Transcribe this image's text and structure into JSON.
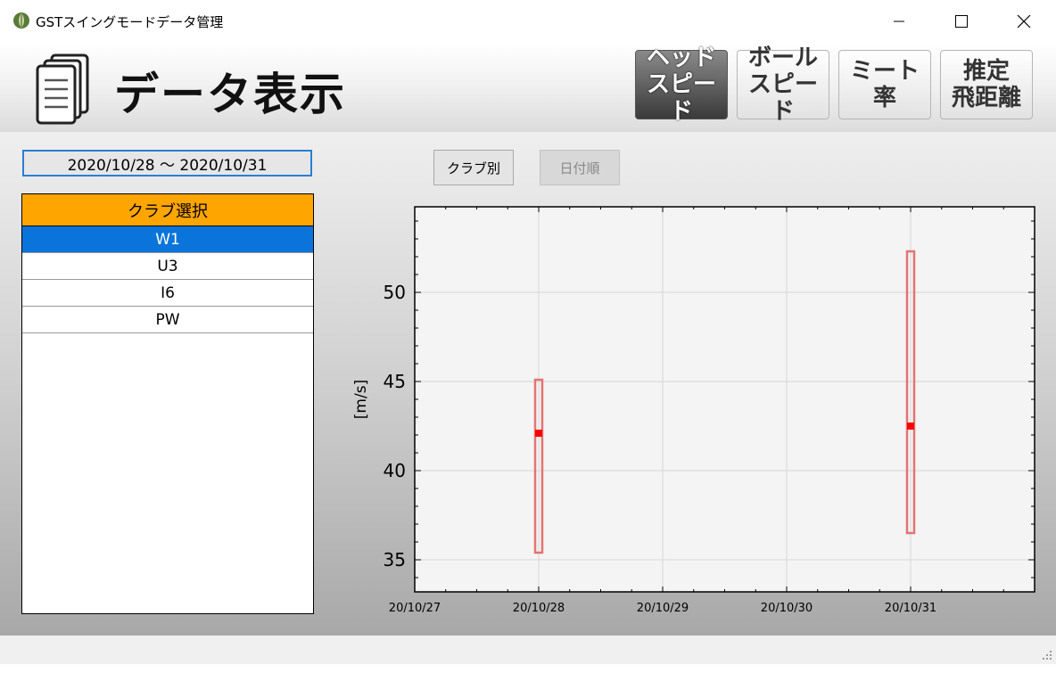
{
  "window": {
    "title": "GSTスイングモードデータ管理"
  },
  "header": {
    "title": "データ表示",
    "metrics": [
      {
        "label": "ヘッド\nスピード",
        "active": true
      },
      {
        "label": "ボール\nスピード",
        "active": false
      },
      {
        "label": "ミート率",
        "active": false
      },
      {
        "label": "推定\n飛距離",
        "active": false
      }
    ]
  },
  "date_range": "2020/10/28 ～ 2020/10/31",
  "club_panel": {
    "header": "クラブ選択",
    "items": [
      "W1",
      "U3",
      "I6",
      "PW"
    ],
    "selected": "W1"
  },
  "sort_buttons": {
    "by_club": "クラブ別",
    "by_date": "日付順"
  },
  "colors": {
    "accent": "#0a74da",
    "header_orange": "#ffa500",
    "range_box": "#e57373",
    "mean_marker": "#ff0000"
  },
  "chart_data": {
    "type": "range",
    "ylabel": "[m/s]",
    "xlabel": "",
    "x_ticks": [
      "20/10/27",
      "20/10/28",
      "20/10/29",
      "20/10/30",
      "20/10/31"
    ],
    "xlim": [
      "20/10/27",
      "20/11/01"
    ],
    "ylim": [
      33.2,
      54.8
    ],
    "y_ticks": [
      35,
      40,
      45,
      50
    ],
    "grid": true,
    "series": [
      {
        "points": [
          {
            "x": "20/10/28",
            "min": 35.4,
            "max": 45.1,
            "mean": 42.1
          },
          {
            "x": "20/10/31",
            "min": 36.5,
            "max": 52.3,
            "mean": 42.5
          }
        ]
      }
    ]
  }
}
